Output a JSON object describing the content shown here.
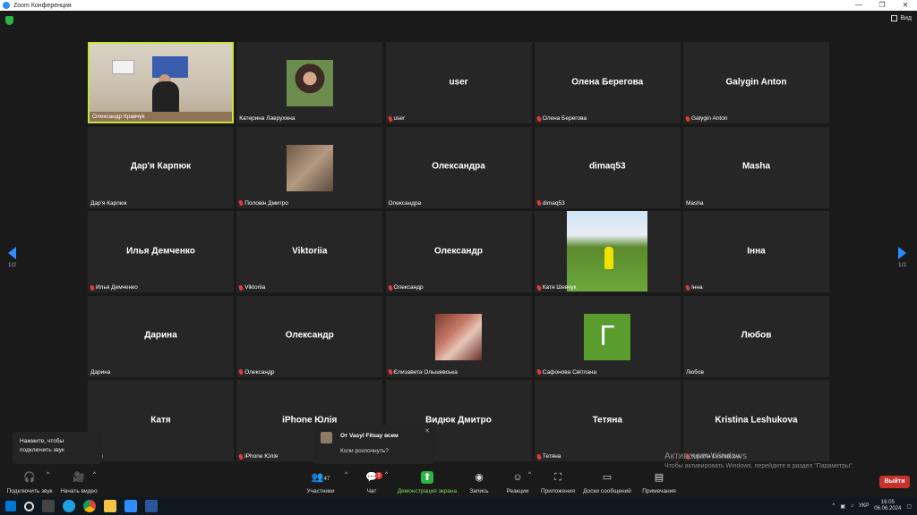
{
  "window": {
    "title": "Zoom Конференция"
  },
  "topbar": {
    "view_label": "Вид"
  },
  "page_indicator": {
    "left": "1/2",
    "right": "1/2"
  },
  "tiles": [
    {
      "name": "",
      "label": "Олександр Кравчук",
      "muted": false,
      "kind": "video"
    },
    {
      "name": "",
      "label": "Катерина Лаврухина",
      "muted": false,
      "kind": "photo1"
    },
    {
      "name": "user",
      "label": "user",
      "muted": true,
      "kind": "name"
    },
    {
      "name": "Олена Берегова",
      "label": "Олена Берегова",
      "muted": true,
      "kind": "name"
    },
    {
      "name": "Galygin Anton",
      "label": "Galygin Anton",
      "muted": true,
      "kind": "name"
    },
    {
      "name": "Дар'я Карпюк",
      "label": "Дар'я Карпюк",
      "muted": false,
      "kind": "name"
    },
    {
      "name": "",
      "label": "Половін Дмитро",
      "muted": true,
      "kind": "photo2"
    },
    {
      "name": "Олександра",
      "label": "Олександра",
      "muted": false,
      "kind": "name"
    },
    {
      "name": "dimaq53",
      "label": "dimaq53",
      "muted": true,
      "kind": "name"
    },
    {
      "name": "Masha",
      "label": "Masha",
      "muted": false,
      "kind": "name"
    },
    {
      "name": "Илья Демченко",
      "label": "Илья Демченко",
      "muted": true,
      "kind": "name"
    },
    {
      "name": "Viktoriia",
      "label": "Viktoriia",
      "muted": true,
      "kind": "name"
    },
    {
      "name": "Олександр",
      "label": "Олександр",
      "muted": true,
      "kind": "name"
    },
    {
      "name": "",
      "label": "Катя Шевчук",
      "muted": true,
      "kind": "photo3"
    },
    {
      "name": "Інна",
      "label": "Інна",
      "muted": true,
      "kind": "name"
    },
    {
      "name": "Дарина",
      "label": "Дарина",
      "muted": false,
      "kind": "name"
    },
    {
      "name": "Олександр",
      "label": "Олександр",
      "muted": true,
      "kind": "name"
    },
    {
      "name": "",
      "label": "Єлизавета Ольшевська",
      "muted": true,
      "kind": "photo4"
    },
    {
      "name": "Г",
      "label": "Сафонова Світлана",
      "muted": true,
      "kind": "avatarG"
    },
    {
      "name": "Любов",
      "label": "Любов",
      "muted": false,
      "kind": "name"
    },
    {
      "name": "Катя",
      "label": "Катя",
      "muted": false,
      "kind": "name"
    },
    {
      "name": "iPhone Юлія",
      "label": "iPhone Юлія",
      "muted": true,
      "kind": "name"
    },
    {
      "name": "Видюк Дмитро",
      "label": "",
      "muted": false,
      "kind": "name"
    },
    {
      "name": "Тетяна",
      "label": "Тетяна",
      "muted": true,
      "kind": "name"
    },
    {
      "name": "Kristina Leshukova",
      "label": "Kristina Leshukova",
      "muted": true,
      "kind": "name"
    }
  ],
  "audio_tooltip": "Нажмите, чтобы подключить звук",
  "chat_popup": {
    "from": "От Vasyl Fitsay всем",
    "message": "Коли розпочнуть?"
  },
  "watermark": {
    "line1": "Активация Windows",
    "line2": "Чтобы активировать Windows, перейдите в раздел \"Параметры\"."
  },
  "toolbar": {
    "audio": "Подключить звук",
    "video": "Начать видео",
    "participants": "Участники",
    "participants_count": "47",
    "chat": "Чат",
    "chat_badge": "1",
    "share": "Демонстрация экрана",
    "record": "Запись",
    "reactions": "Реакции",
    "apps": "Приложения",
    "whiteboards": "Доски сообщений",
    "notes": "Примечания",
    "leave": "Выйти"
  },
  "taskbar": {
    "lang": "УКР",
    "time": "16:05",
    "date": "06.06.2024"
  },
  "colors": {
    "accent": "#2d8cff",
    "active_speaker": "#c8e23b",
    "leave": "#c9302c",
    "muted": "#e23b3b"
  }
}
